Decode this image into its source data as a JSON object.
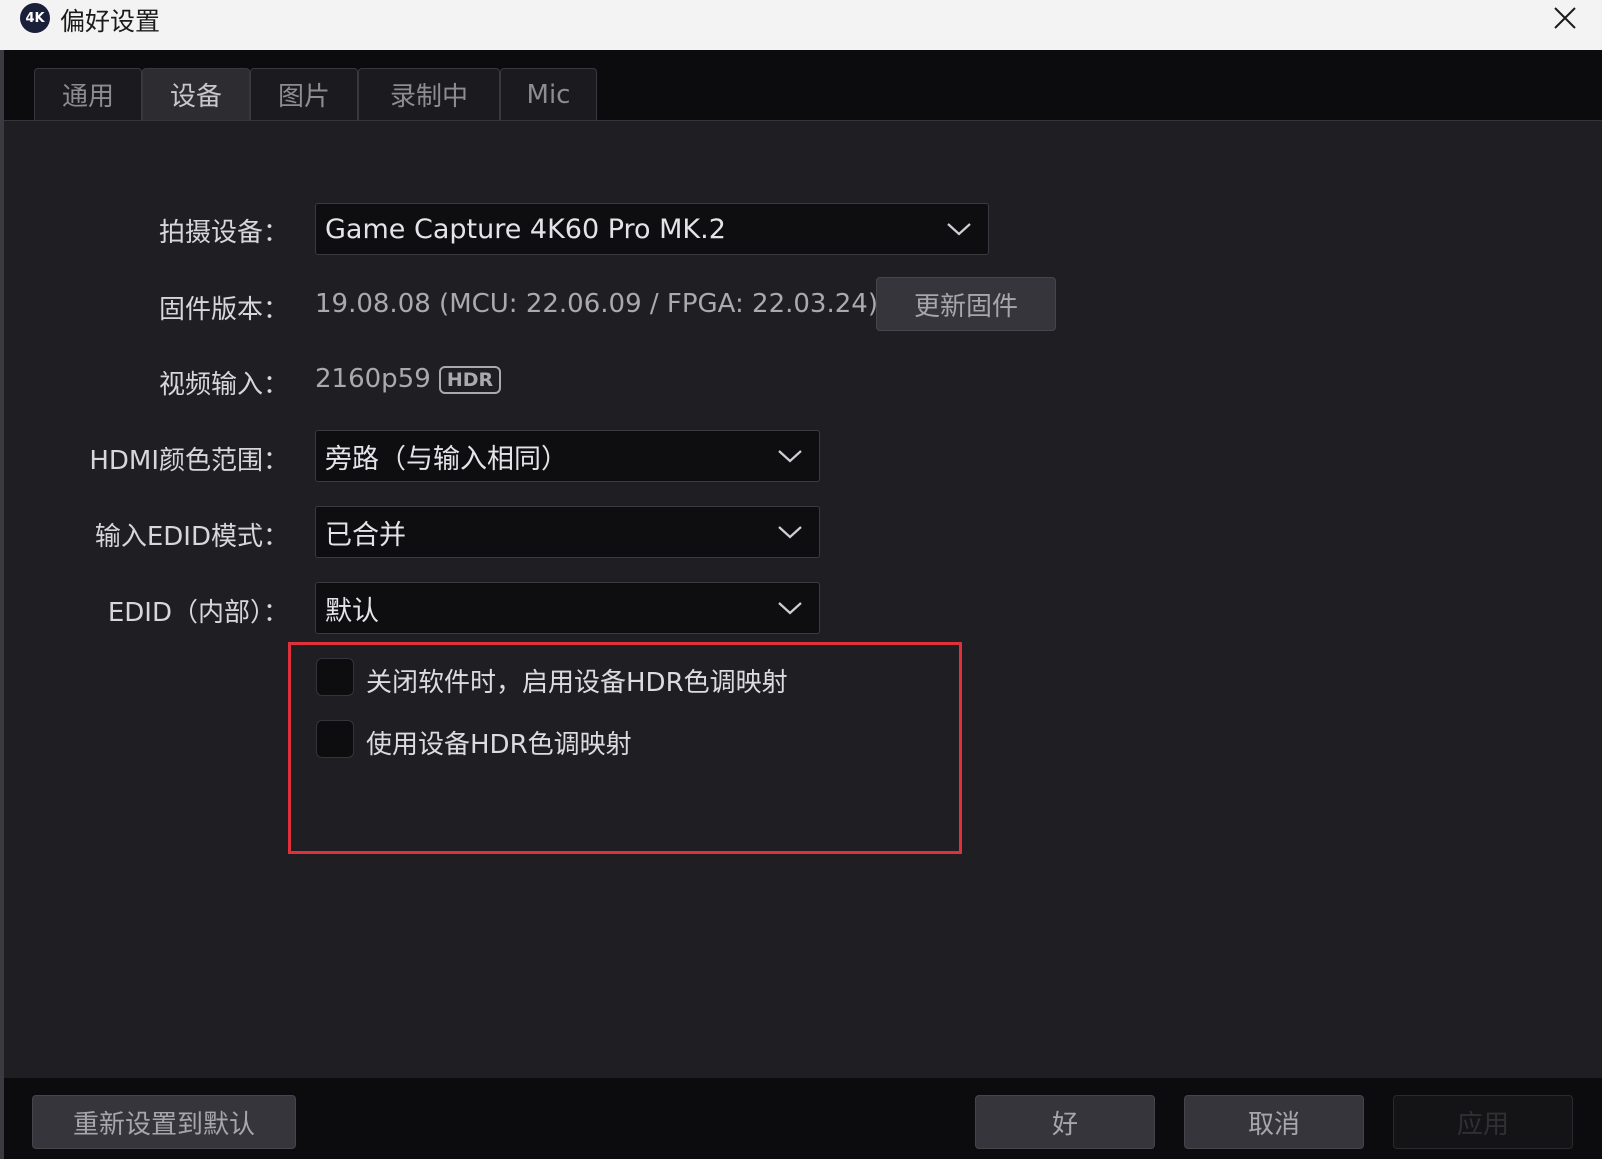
{
  "window": {
    "app_icon_text": "4K",
    "title": "偏好设置"
  },
  "tabs": [
    {
      "label": "通用",
      "active": false
    },
    {
      "label": "设备",
      "active": true
    },
    {
      "label": "图片",
      "active": false
    },
    {
      "label": "录制中",
      "active": false
    },
    {
      "label": "Mic",
      "active": false
    }
  ],
  "device": {
    "capture_label": "拍摄设备：",
    "capture_value": "Game Capture 4K60 Pro MK.2",
    "firmware_label": "固件版本：",
    "firmware_value": "19.08.08 (MCU: 22.06.09 / FPGA: 22.03.24)",
    "update_firmware_button": "更新固件",
    "video_input_label": "视频输入：",
    "video_input_value": "2160p59",
    "hdr_badge": "HDR",
    "hdmi_color_range_label": "HDMI颜色范围：",
    "hdmi_color_range_value": "旁路（与输入相同）",
    "input_edid_mode_label": "输入EDID模式：",
    "input_edid_mode_value": "已合并",
    "edid_internal_label": "EDID（内部）：",
    "edid_internal_value": "默认"
  },
  "hdr_options": {
    "tone_map_on_close_label": "关闭软件时，启用设备HDR色调映射",
    "tone_map_on_close_checked": false,
    "use_tone_map_label": "使用设备HDR色调映射",
    "use_tone_map_checked": false,
    "highlight_color": "#e0303c"
  },
  "footer": {
    "reset_button": "重新设置到默认",
    "ok_button": "好",
    "cancel_button": "取消",
    "apply_button": "应用",
    "apply_enabled": false
  },
  "colors": {
    "background": "#1e1e23",
    "titlebar": "#f3f3f3",
    "bar": "#0c0c0e"
  }
}
